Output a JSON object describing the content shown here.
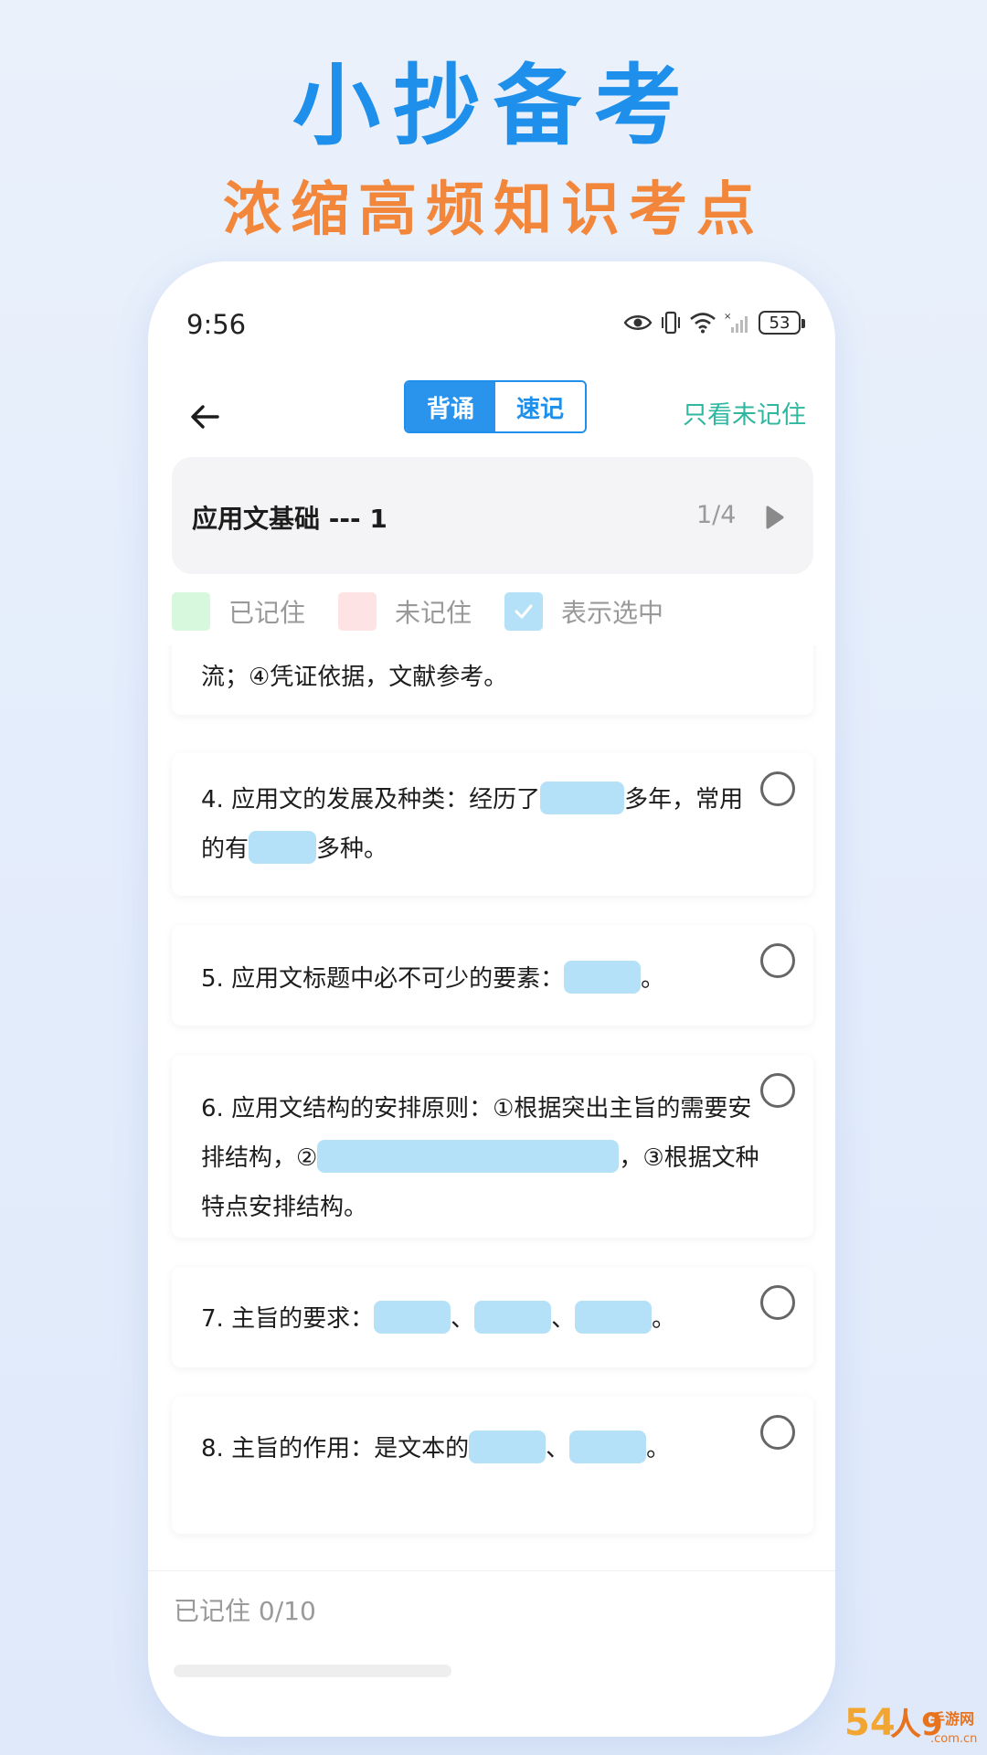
{
  "hero": {
    "title": "小抄备考",
    "subtitle": "浓缩高频知识考点"
  },
  "status_bar": {
    "time": "9:56",
    "battery": "53",
    "icons": [
      "eye-icon",
      "vibrate-icon",
      "wifi-icon",
      "signal-icon",
      "battery-icon"
    ]
  },
  "nav": {
    "tabs": [
      {
        "label": "背诵",
        "active": true
      },
      {
        "label": "速记",
        "active": false
      }
    ],
    "filter_label": "只看未记住"
  },
  "chapter": {
    "title": "应用文基础 --- 1",
    "page": "1/4"
  },
  "legend": [
    {
      "label": "已记住",
      "color": "#d7f8dc"
    },
    {
      "label": "未记住",
      "color": "#fde3e3"
    },
    {
      "label": "表示选中",
      "color": "#b5e1f8"
    }
  ],
  "cards": [
    {
      "id": 0,
      "text": "流；④凭证依据，文献参考。"
    },
    {
      "id": 1,
      "parts": [
        "4. 应用文的发展及种类：经历了",
        "多年，常用的有",
        "多种。"
      ]
    },
    {
      "id": 2,
      "parts": [
        "5. 应用文标题中必不可少的要素：",
        "。"
      ]
    },
    {
      "id": 3,
      "parts": [
        "6. 应用文结构的安排原则：①根据突出主旨的需要安排结构，②",
        "，③根据文种特点安排结构。"
      ]
    },
    {
      "id": 4,
      "parts": [
        "7. 主旨的要求：",
        "、",
        "、",
        "。"
      ]
    },
    {
      "id": 5,
      "parts": [
        "8. 主旨的作用：是文本的",
        "、",
        "。"
      ]
    }
  ],
  "footer": {
    "memorized_label": "已记住 0/10",
    "progress": 0
  },
  "watermark": {
    "text": "54人9手游网",
    "domain": ".com.cn"
  },
  "colors": {
    "accent": "#1e8fea",
    "hero_sub": "#f2873c",
    "teal": "#2fb7a0",
    "blank": "#b5e1f8"
  }
}
